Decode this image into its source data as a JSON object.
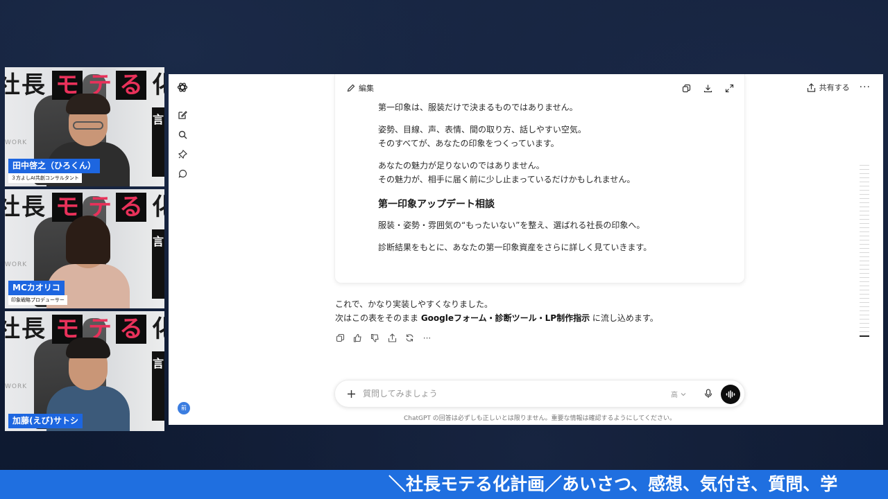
{
  "participants": [
    {
      "name": "田中啓之（ひろくん）",
      "role": "３方よしAI共創コンサルタント",
      "hair": "#2a211c",
      "body": "#2d2d2d"
    },
    {
      "name": "MCカオリコ",
      "role": "印象戦略プロデューサー",
      "hair": "#2b1d16",
      "body": "#d9b3a1"
    },
    {
      "name": "加藤(えび)サトシ",
      "role": "",
      "hair": "#1e1a18",
      "body": "#3c5a7a"
    }
  ],
  "poster": {
    "glyph_1": "長",
    "glyph_2": "モ",
    "glyph_3": "テ",
    "glyph_4": "る",
    "glyph_left": "社",
    "glyph_right": "化",
    "side_text": "言",
    "work_text": "WORK"
  },
  "chatgpt": {
    "share_label": "共有する",
    "edit_label": "編集",
    "document": {
      "line_1": "第一印象は、服装だけで決まるものではありません。",
      "line_2a": "姿勢、目線、声、表情、間の取り方、話しやすい空気。",
      "line_2b": "そのすべてが、あなたの印象をつくっています。",
      "line_3a": "あなたの魅力が足りないのではありません。",
      "line_3b": "その魅力が、相手に届く前に少し止まっているだけかもしれません。",
      "heading": "第一印象アップデート相談",
      "line_4": "服装・姿勢・雰囲気の“もったいない”を整え、選ばれる社長の印象へ。",
      "line_5": "診断結果をもとに、あなたの第一印象資産をさらに詳しく見ていきます。"
    },
    "reply": {
      "line_1": "これで、かなり実装しやすくなりました。",
      "line_2_prefix": "次はこの表をそのまま ",
      "line_2_bold": "Googleフォーム・診断ツール・LP制作指示",
      "line_2_suffix": " に流し込めます。"
    },
    "composer": {
      "placeholder": "質問してみましょう",
      "model_label": "高"
    },
    "disclaimer": "ChatGPT の回答は必ずしも正しいとは限りません。重要な情報は確認するようにしてください。",
    "avatar_text": "前"
  },
  "ticker": {
    "text": "＼社長モテる化計画／あいさつ、感想、気付き、質問、学"
  },
  "colors": {
    "accent_blue": "#1f6fe0",
    "name_tag": "#1d66e0",
    "poster_pink": "#e8315a"
  }
}
